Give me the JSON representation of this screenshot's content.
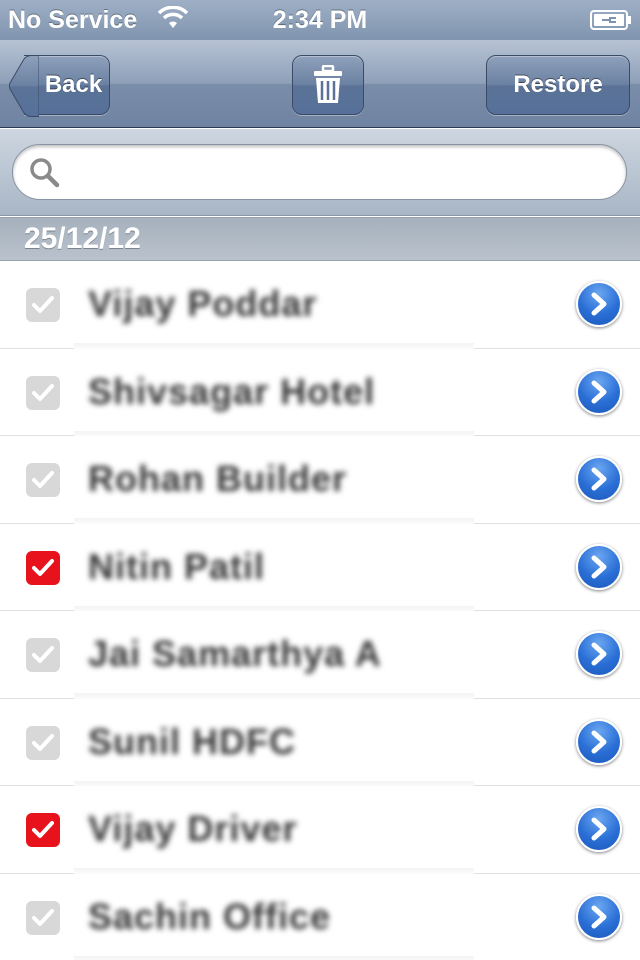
{
  "status_bar": {
    "carrier": "No Service",
    "wifi_icon": "wifi-icon",
    "time": "2:34 PM",
    "battery_icon": "battery-charging-icon"
  },
  "nav_bar": {
    "back_label": "Back",
    "trash_icon": "trash-icon",
    "restore_label": "Restore"
  },
  "search": {
    "placeholder": "",
    "value": "",
    "icon": "search-icon"
  },
  "section": {
    "header": "25/12/12"
  },
  "colors": {
    "checked": "#e8121c",
    "unchecked": "#d8d8d8",
    "disclosure": "#2a6fd6"
  },
  "contacts": [
    {
      "name": "Vijay Poddar",
      "checked": false
    },
    {
      "name": "Shivsagar Hotel",
      "checked": false
    },
    {
      "name": "Rohan Builder",
      "checked": false
    },
    {
      "name": "Nitin Patil",
      "checked": true
    },
    {
      "name": "Jai Samarthya A",
      "checked": false
    },
    {
      "name": "Sunil HDFC",
      "checked": false
    },
    {
      "name": "Vijay Driver",
      "checked": true
    },
    {
      "name": "Sachin Office",
      "checked": false
    }
  ]
}
